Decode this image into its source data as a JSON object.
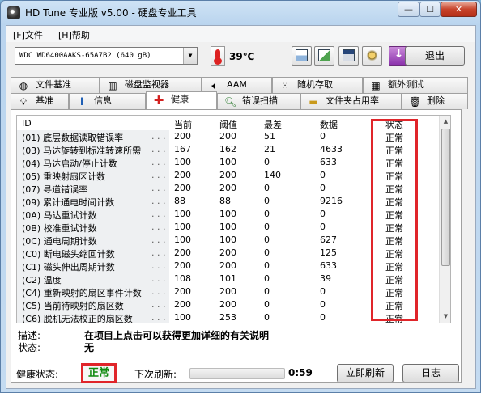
{
  "window": {
    "title": "HD Tune 专业版 v5.00 - 硬盘专业工具",
    "controls": {
      "minimize": "—",
      "maximize": "☐",
      "close": "✕"
    }
  },
  "menu": {
    "file": "[F]文件",
    "help": "[H]帮助"
  },
  "toolbar": {
    "drive": "WDC WD6400AAKS-65A7B2 (640 gB)",
    "temperature": "39℃",
    "exit_label": "退出",
    "icons": [
      "copy-text-icon",
      "copy-info-icon",
      "save-icon",
      "options-icon",
      "download-icon"
    ]
  },
  "tabs_row1": [
    {
      "label": "文件基准",
      "icon": "file-benchmark-icon"
    },
    {
      "label": "磁盘监视器",
      "icon": "disk-monitor-icon"
    },
    {
      "label": "AAM",
      "icon": "speaker-icon"
    },
    {
      "label": "随机存取",
      "icon": "random-access-icon"
    },
    {
      "label": "额外测试",
      "icon": "extra-tests-icon"
    }
  ],
  "tabs_row2": [
    {
      "label": "基准",
      "icon": "benchmark-icon"
    },
    {
      "label": "信息",
      "icon": "info-icon"
    },
    {
      "label": "健康",
      "icon": "health-cross-icon",
      "active": true
    },
    {
      "label": "错误扫描",
      "icon": "magnifier-icon"
    },
    {
      "label": "文件夹占用率",
      "icon": "folder-icon"
    },
    {
      "label": "删除",
      "icon": "trash-icon"
    }
  ],
  "table": {
    "headers": {
      "id": "ID",
      "current": "当前",
      "threshold": "阈值",
      "worst": "最差",
      "data": "数据",
      "status": "状态"
    },
    "rows": [
      {
        "id": "(01) 底层数据读取错误率",
        "current": "200",
        "threshold": "200",
        "worst": "51",
        "data": "0",
        "status": "正常"
      },
      {
        "id": "(03) 马达旋转到标准转速所需",
        "current": "167",
        "threshold": "162",
        "worst": "21",
        "data": "4633",
        "status": "正常"
      },
      {
        "id": "(04) 马达启动/停止计数",
        "current": "100",
        "threshold": "100",
        "worst": "0",
        "data": "633",
        "status": "正常"
      },
      {
        "id": "(05) 重映射扇区计数",
        "current": "200",
        "threshold": "200",
        "worst": "140",
        "data": "0",
        "status": "正常"
      },
      {
        "id": "(07) 寻道错误率",
        "current": "200",
        "threshold": "200",
        "worst": "0",
        "data": "0",
        "status": "正常"
      },
      {
        "id": "(09) 累计通电时间计数",
        "current": "88",
        "threshold": "88",
        "worst": "0",
        "data": "9216",
        "status": "正常"
      },
      {
        "id": "(0A) 马达重试计数",
        "current": "100",
        "threshold": "100",
        "worst": "0",
        "data": "0",
        "status": "正常"
      },
      {
        "id": "(0B) 校准重试计数",
        "current": "100",
        "threshold": "100",
        "worst": "0",
        "data": "0",
        "status": "正常"
      },
      {
        "id": "(0C) 通电周期计数",
        "current": "100",
        "threshold": "100",
        "worst": "0",
        "data": "627",
        "status": "正常"
      },
      {
        "id": "(C0) 断电磁头缩回计数",
        "current": "200",
        "threshold": "200",
        "worst": "0",
        "data": "125",
        "status": "正常"
      },
      {
        "id": "(C1) 磁头伸出周期计数",
        "current": "200",
        "threshold": "200",
        "worst": "0",
        "data": "633",
        "status": "正常"
      },
      {
        "id": "(C2) 温度",
        "current": "108",
        "threshold": "101",
        "worst": "0",
        "data": "39",
        "status": "正常"
      },
      {
        "id": "(C4) 重新映射的扇区事件计数",
        "current": "200",
        "threshold": "200",
        "worst": "0",
        "data": "0",
        "status": "正常"
      },
      {
        "id": "(C5) 当前待映射的扇区数",
        "current": "200",
        "threshold": "200",
        "worst": "0",
        "data": "0",
        "status": "正常"
      },
      {
        "id": "(C6) 脱机无法校正的扇区数",
        "current": "100",
        "threshold": "253",
        "worst": "0",
        "data": "0",
        "status": "正常"
      }
    ]
  },
  "details": {
    "description_label": "描述:",
    "description_value": "在项目上点击可以获得更加详细的有关说明",
    "status_label": "状态:",
    "status_value": "无"
  },
  "footer": {
    "health_label": "健康状态:",
    "health_value": "正常",
    "next_refresh_label": "下次刷新:",
    "countdown": "0:59",
    "refresh_now": "立即刷新",
    "log": "日志"
  }
}
